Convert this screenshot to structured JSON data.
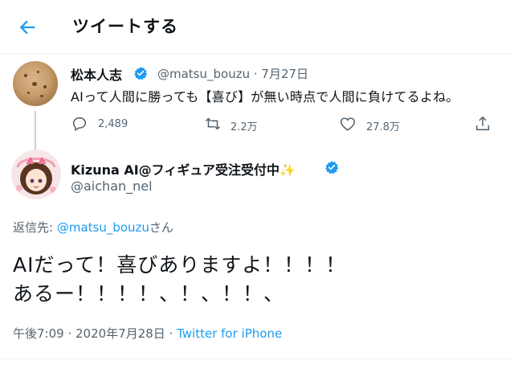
{
  "header": {
    "title": "ツイートする"
  },
  "tweet1": {
    "name": "松本人志",
    "handle": "@matsu_bouzu",
    "date": "7月27日",
    "text": "AIって人間に勝っても【喜び】が無い時点で人間に負けてるよね。",
    "replies": "2,489",
    "retweets": "2.2万",
    "likes": "27.8万"
  },
  "tweet2": {
    "name": "Kizuna AI@フィギュア受注受付中✨",
    "handle": "@aichan_nel",
    "reply_prefix": "返信先: ",
    "reply_user": "@matsu_bouzu",
    "reply_suffix": "さん",
    "text_line1": "AIだって！喜びありますよ！！！！",
    "text_line2": "あるー！！！！、！、！！、",
    "time": "午後7:09 · 2020年7月28日 · ",
    "source": "Twitter for iPhone"
  },
  "colors": {
    "accent": "#1d9bf0",
    "secondary_text": "#536471",
    "primary_text": "#0f1419"
  },
  "icons": [
    "back-arrow-icon",
    "verified-badge-icon",
    "reply-icon",
    "retweet-icon",
    "like-icon",
    "share-icon"
  ]
}
